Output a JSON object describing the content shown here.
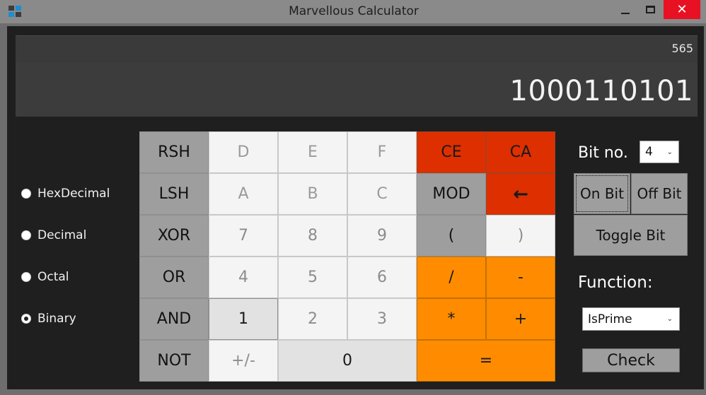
{
  "window": {
    "title": "Marvellous Calculator",
    "icons": {
      "app": "calculator-icon",
      "minimize": "minimize-icon",
      "maximize": "maximize-icon",
      "close": "close-icon"
    },
    "close_glyph": "✕",
    "close_color": "#e81123"
  },
  "display": {
    "secondary_value": "565",
    "primary_value": "1000110101"
  },
  "radix": {
    "options": [
      {
        "label": "HexDecimal",
        "checked": false
      },
      {
        "label": "Decimal",
        "checked": false
      },
      {
        "label": "Octal",
        "checked": false
      },
      {
        "label": "Binary",
        "checked": true
      }
    ]
  },
  "keypad": {
    "rows": [
      [
        "RSH",
        "D",
        "E",
        "F",
        "CE",
        "CA"
      ],
      [
        "LSH",
        "A",
        "B",
        "C",
        "MOD",
        "←"
      ],
      [
        "XOR",
        "7",
        "8",
        "9",
        "(",
        ")"
      ],
      [
        "OR",
        "4",
        "5",
        "6",
        "/",
        "-"
      ],
      [
        "AND",
        "1",
        "2",
        "3",
        "*",
        "+"
      ],
      [
        "NOT",
        "+/-",
        "0",
        "="
      ]
    ],
    "backspace_icon": "left-arrow-icon"
  },
  "bit_panel": {
    "label": "Bit no.",
    "selected_bit": "4",
    "on_bit": "On Bit",
    "off_bit": "Off Bit",
    "toggle_bit": "Toggle Bit"
  },
  "function_panel": {
    "label": "Function:",
    "selected_function": "IsPrime",
    "check": "Check"
  },
  "colors": {
    "accent_red": "#de2f00",
    "accent_orange": "#ff8c00",
    "operator_gray": "#9e9e9e",
    "background": "#1f1f1f"
  }
}
